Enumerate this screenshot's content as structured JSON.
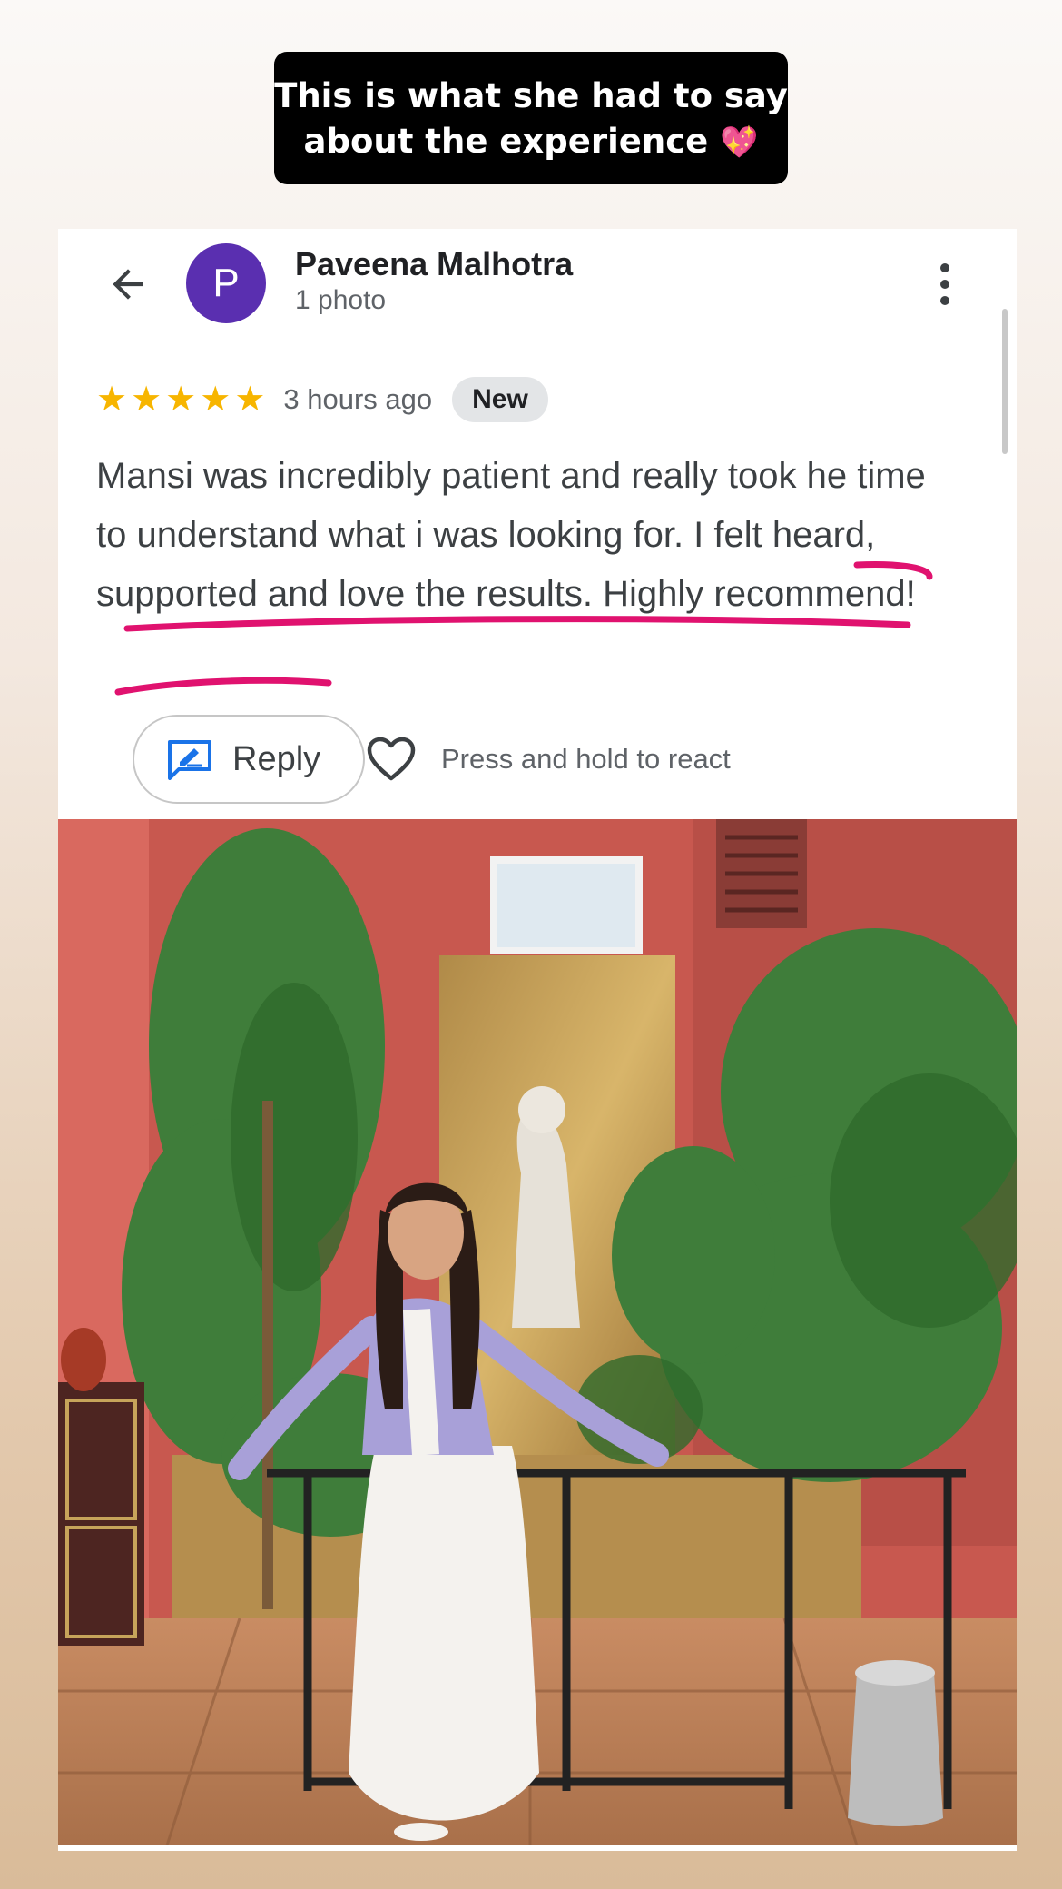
{
  "caption": {
    "line1": "This is what she had to say",
    "line2": "about the experience",
    "emoji": "💖"
  },
  "review": {
    "author": "Paveena Malhotra",
    "avatar_letter": "P",
    "photo_count": "1 photo",
    "rating": 5,
    "stars": [
      "★",
      "★",
      "★",
      "★",
      "★"
    ],
    "time": "3 hours ago",
    "badge": "New",
    "text": "Mansi was incredibly patient and really took he time to understand what i was looking for. I felt heard, supported and love the results. Highly recommend!",
    "reply_label": "Reply",
    "react_hint": "Press and hold to react"
  },
  "colors": {
    "star": "#f7b500",
    "avatar": "#5a2fb0",
    "underline": "#e0126f",
    "accent": "#1a73e8"
  },
  "icons": {
    "back": "arrow-left-icon",
    "more": "more-vertical-icon",
    "reply": "reply-edit-icon",
    "react": "heart-outline-icon"
  }
}
